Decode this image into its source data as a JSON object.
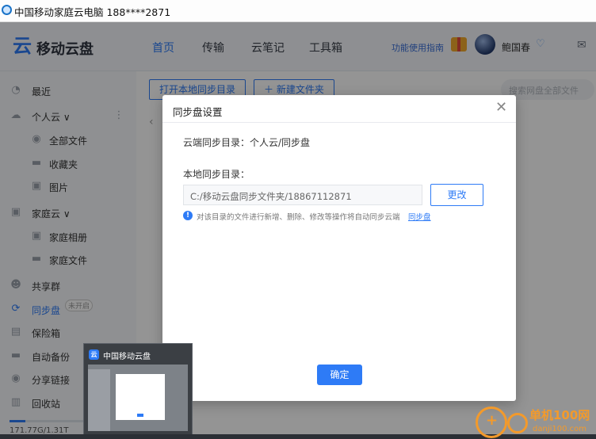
{
  "window": {
    "title": "中国移动家庭云电脑 188****2871"
  },
  "header": {
    "logo_icon": "云",
    "app_name": "移动云盘",
    "nav": [
      "首页",
      "传输",
      "云笔记",
      "工具箱"
    ],
    "active_nav": "首页",
    "guide_link": "功能使用指南",
    "username": "鲍国春",
    "vip_icon": "♡",
    "mail_icon": "✉"
  },
  "sidebar": {
    "recent": "最近",
    "personal_cloud": "个人云 ∨",
    "more_icon": "⋮",
    "all_files": "全部文件",
    "favorites": "收藏夹",
    "photos": "图片",
    "family_cloud": "家庭云 ∨",
    "family_album": "家庭相册",
    "family_files": "家庭文件",
    "share_group": "共享群",
    "sync_disk": "同步盘",
    "sync_badge": "未开启",
    "safe_box": "保险箱",
    "auto_backup": "自动备份",
    "share_link": "分享链接",
    "recycle_bin": "回收站",
    "storage": "171.77G/1.31T",
    "storage_used_fraction": 0.13
  },
  "toolbar": {
    "open_local_sync": "打开本地同步目录",
    "new_folder": "＋ 新建文件夹",
    "search_placeholder": "搜索网盘全部文件",
    "back_icon": "‹"
  },
  "dialog": {
    "title": "同步盘设置",
    "close_icon": "✕",
    "cloud_dir": "云端同步目录：个人云/同步盘",
    "local_label": "本地同步目录：",
    "local_path": "C:/移动云盘同步文件夹/18867112871",
    "change_button": "更改",
    "tip_icon": "!",
    "tip_text": "对该目录的文件进行新增、删除、修改等操作将自动同步云端",
    "tip_link": "同步盘",
    "confirm_button": "确定"
  },
  "taskbar_thumbnail": {
    "icon": "云",
    "title": "中国移动云盘"
  },
  "watermark": {
    "text": "单机100网",
    "sub": "danji100.com"
  },
  "colors": {
    "accent": "#2e7bf6",
    "overlay": "rgba(0,0,0,0.42)",
    "watermark": "#f39a2b"
  }
}
